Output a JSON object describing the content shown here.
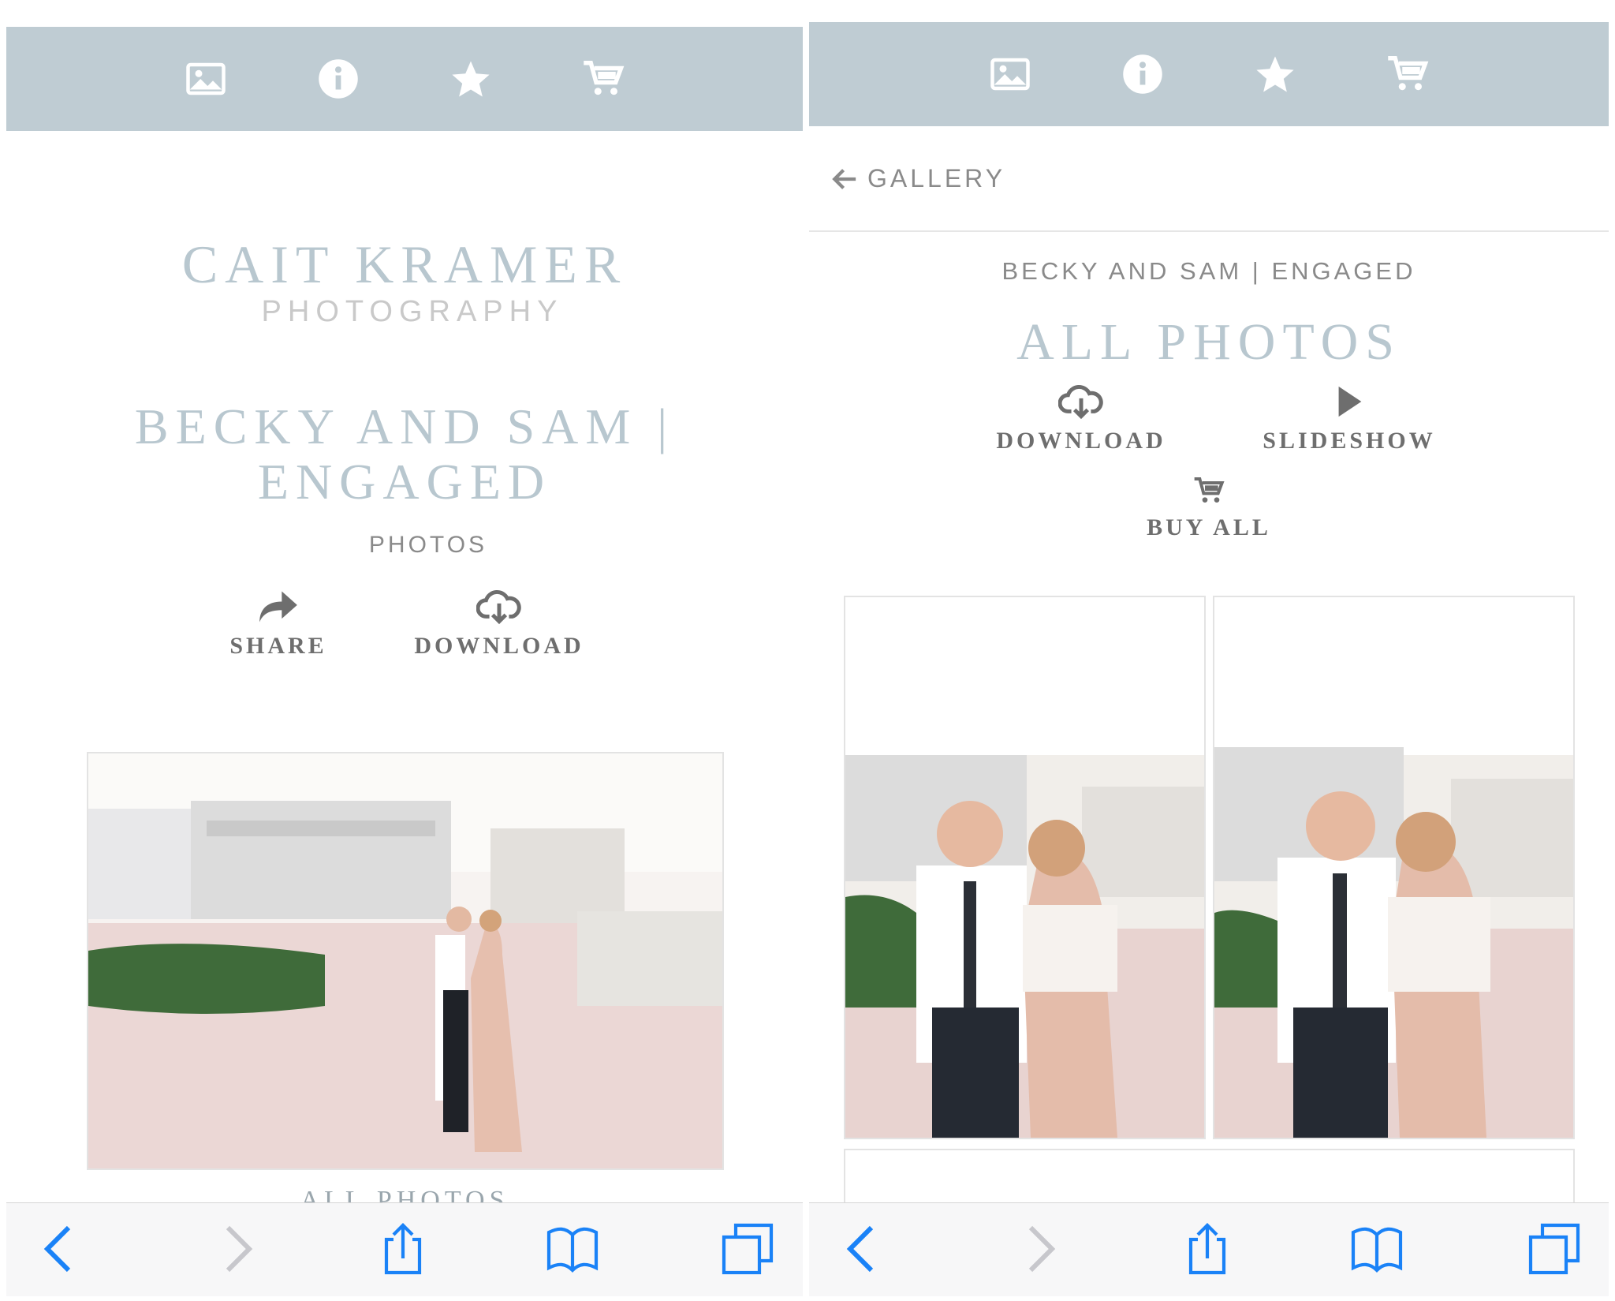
{
  "left": {
    "nav_icons": [
      "gallery-icon",
      "info-icon",
      "star-icon",
      "cart-icon"
    ],
    "brand_name": "CAIT KRAMER",
    "brand_sub": "PHOTOGRAPHY",
    "gallery_title_line1": "BECKY AND SAM |",
    "gallery_title_line2": "ENGAGED",
    "section_label": "PHOTOS",
    "actions": [
      {
        "label": "SHARE",
        "icon": "share-icon"
      },
      {
        "label": "DOWNLOAD",
        "icon": "cloud-download-icon"
      }
    ],
    "below_photo_label": "ALL PHOTOS"
  },
  "right": {
    "nav_icons": [
      "gallery-icon",
      "info-icon",
      "star-icon",
      "cart-icon"
    ],
    "back_label": "GALLERY",
    "gallery_name": "BECKY AND SAM | ENGAGED",
    "album_title": "ALL PHOTOS",
    "actions": [
      {
        "label": "DOWNLOAD",
        "icon": "cloud-download-icon"
      },
      {
        "label": "SLIDESHOW",
        "icon": "play-icon"
      },
      {
        "label": "BUY ALL",
        "icon": "cart-icon"
      }
    ]
  },
  "browser_toolbar": [
    "back-icon",
    "forward-icon",
    "share-icon",
    "bookmarks-icon",
    "tabs-icon"
  ],
  "colors": {
    "nav_bar": "#bfccd3",
    "title_text": "#b8c7cf",
    "label_text": "#6e6e6e",
    "ios_blue": "#1a82f7"
  }
}
